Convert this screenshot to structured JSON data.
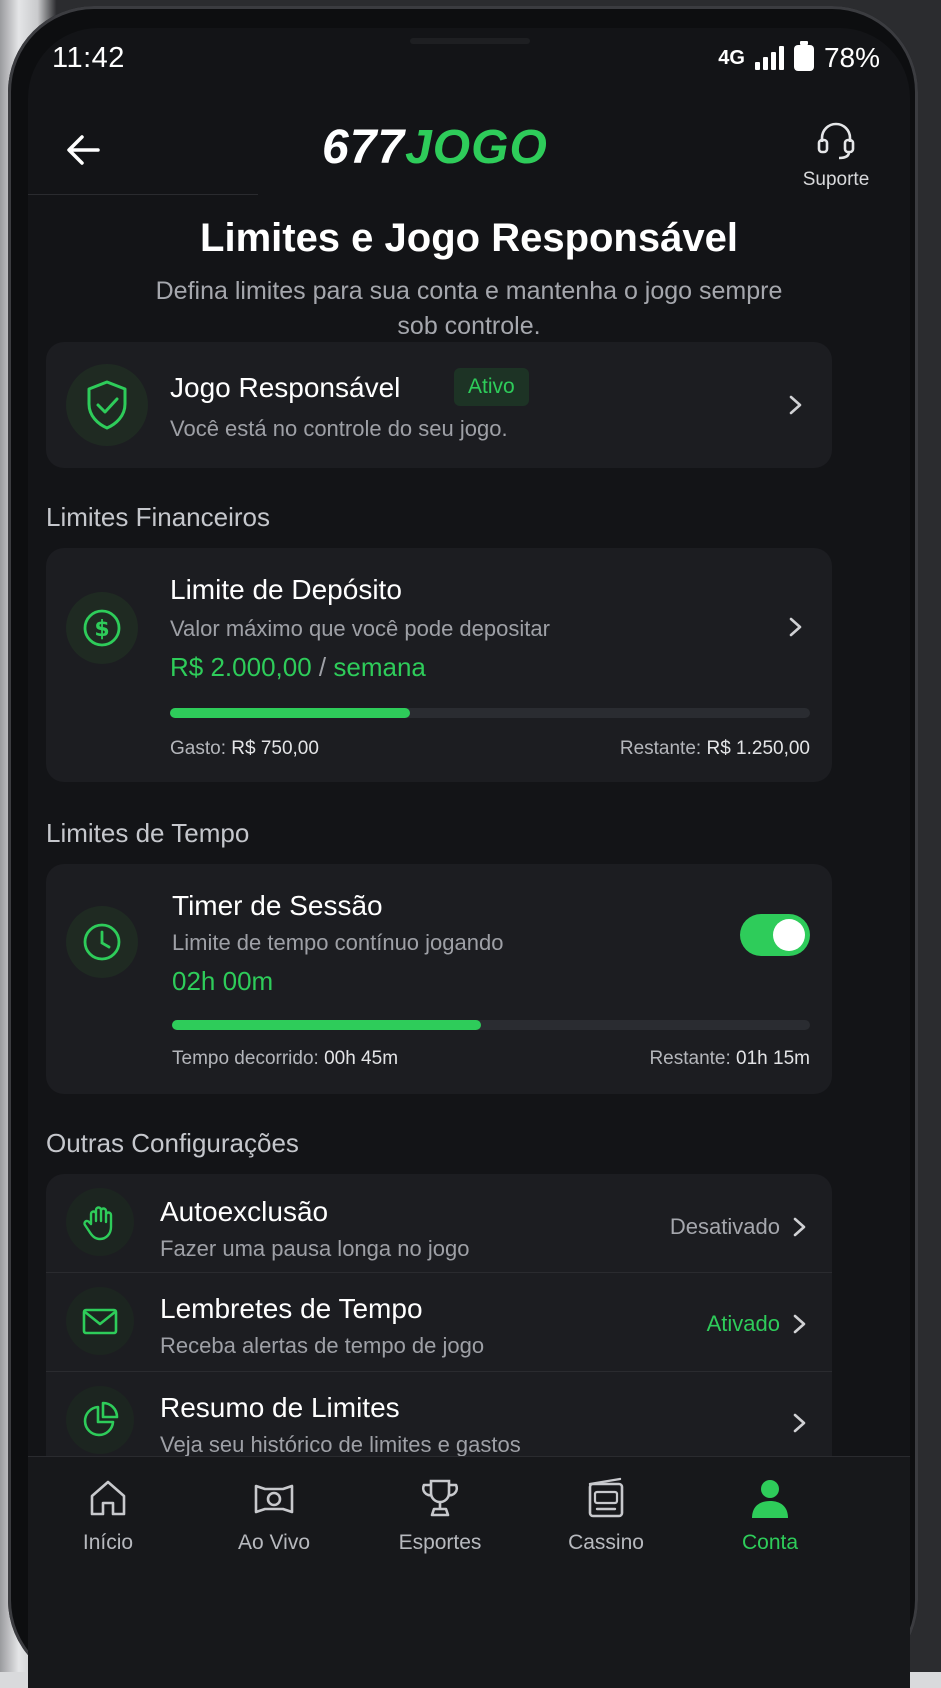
{
  "status_bar": {
    "time": "11:42",
    "network": "4G",
    "battery": "78%"
  },
  "header": {
    "logo_white": "677",
    "logo_green": "JOGO",
    "support_label": "Suporte"
  },
  "page": {
    "title": "Limites e Jogo Responsável",
    "subtitle": "Defina limites para sua conta e mantenha o jogo sempre sob controle."
  },
  "responsible": {
    "title": "Jogo Responsável",
    "badge": "Ativo",
    "description": "Você está no controle do seu jogo."
  },
  "financial": {
    "section_label": "Limites Financeiros",
    "title": "Limite de Depósito",
    "description": "Valor máximo que você pode depositar",
    "amount": "R$ 2.000,00",
    "separator": "/",
    "period": "semana",
    "progress_fraction": 0.375,
    "spent_label": "Gasto:",
    "spent_value": "R$ 750,00",
    "remaining_label": "Restante:",
    "remaining_value": "R$ 1.250,00"
  },
  "time_limits": {
    "section_label": "Limites de Tempo",
    "title": "Timer de Sessão",
    "description": "Limite de tempo contínuo jogando",
    "value": "02h 00m",
    "toggle_on": true,
    "progress_fraction": 0.375,
    "elapsed_label": "Tempo decorrido:",
    "elapsed_value": "00h 45m",
    "remaining_label": "Restante:",
    "remaining_value": "01h 15m"
  },
  "other": {
    "section_label": "Outras Configurações",
    "items": [
      {
        "icon": "hand-icon",
        "title": "Autoexclusão",
        "description": "Fazer uma pausa longa no jogo",
        "status": "Desativado"
      },
      {
        "icon": "mail-icon",
        "title": "Lembretes de Tempo",
        "description": "Receba alertas de tempo de jogo",
        "status": "Ativado"
      },
      {
        "icon": "pie-chart-icon",
        "title": "Resumo de Limites",
        "description": "Veja seu histórico de limites e gastos",
        "status": ""
      }
    ]
  },
  "nav": {
    "items": [
      {
        "label": "Início",
        "icon": "home-icon"
      },
      {
        "label": "Ao Vivo",
        "icon": "live-icon"
      },
      {
        "label": "Esportes",
        "icon": "trophy-icon"
      },
      {
        "label": "Cassino",
        "icon": "slot-machine-icon"
      },
      {
        "label": "Conta",
        "icon": "user-icon",
        "active": true
      }
    ]
  },
  "colors": {
    "accent": "#2ecc5a",
    "background": "#131417",
    "card": "#1c1d21"
  }
}
